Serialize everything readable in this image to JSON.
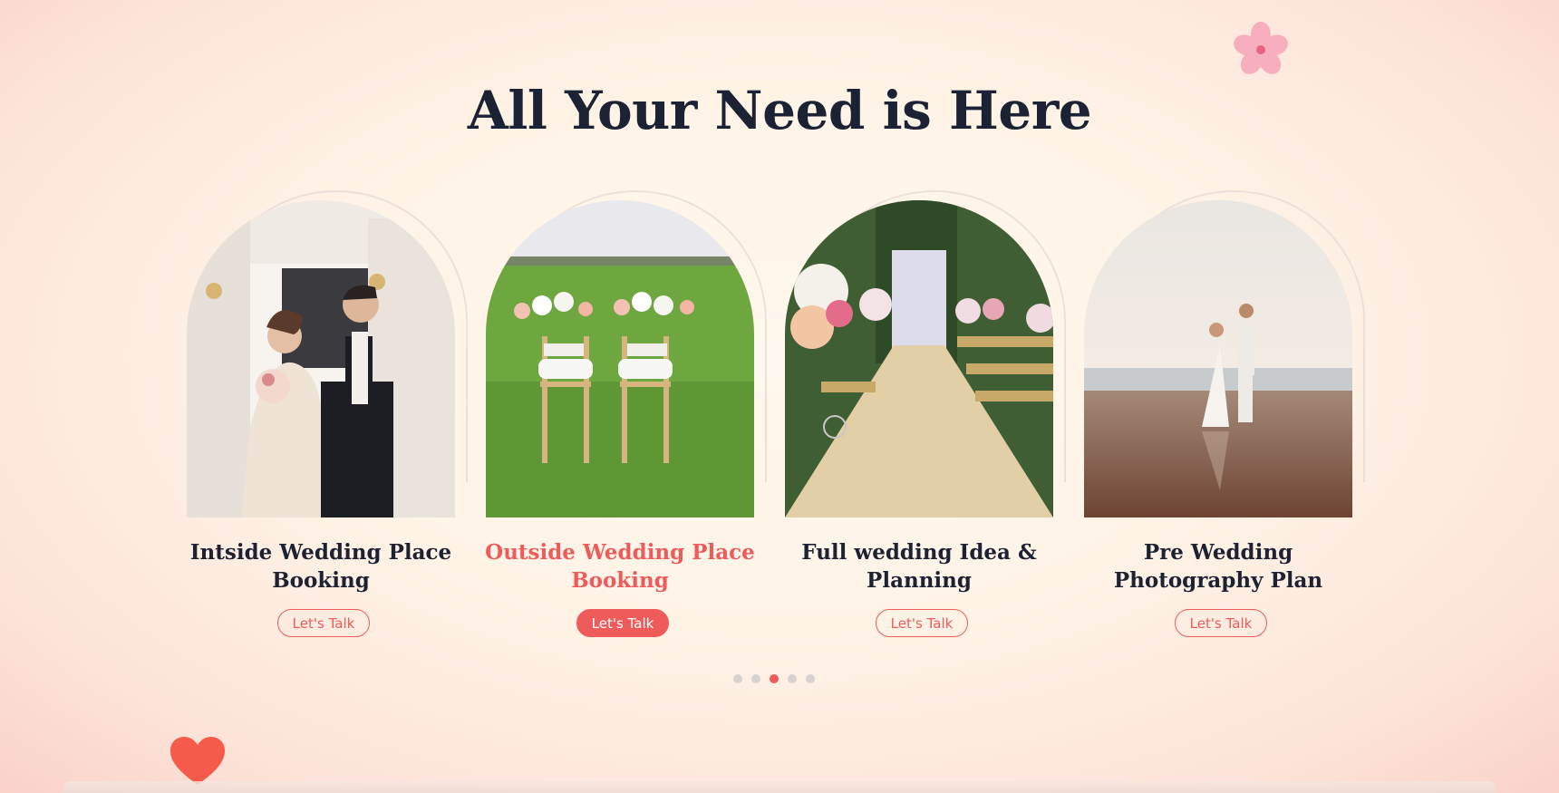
{
  "section": {
    "title": "All Your Need is Here"
  },
  "cards": [
    {
      "title": "Intside Wedding Place Booking",
      "button": "Let's Talk",
      "image": "bride-groom-hallway-photo",
      "active": false
    },
    {
      "title": "Outside Wedding Place Booking",
      "button": "Let's Talk",
      "image": "garden-chairs-photo",
      "active": true
    },
    {
      "title": "Full wedding Idea & Planning",
      "button": "Let's Talk",
      "image": "flower-aisle-photo",
      "active": false
    },
    {
      "title": "Pre Wedding Photography Plan",
      "button": "Let's Talk",
      "image": "beach-couple-photo",
      "active": false
    }
  ],
  "pagination": {
    "count": 5,
    "active_index": 2
  },
  "decor": {
    "flower_icon": "flower-icon",
    "heart_icon": "heart-icon"
  },
  "colors": {
    "accent": "#ef5b5b",
    "heading": "#1b2233",
    "background": "#fff3e6"
  }
}
